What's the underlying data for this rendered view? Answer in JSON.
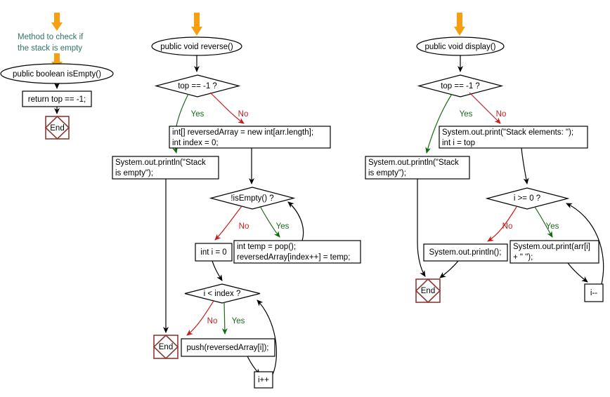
{
  "diagram": {
    "title": "Java Stack methods flowchart",
    "colors": {
      "comment": "#2f7466",
      "yes": "#1a6b1a",
      "no": "#c81c1c",
      "terminator": "#8b3a35",
      "entry_arrow": "#f5a013",
      "edge": "#000000",
      "node_fill": "#ffffff"
    }
  },
  "flows": {
    "is_empty": {
      "comment": {
        "line1": "Method to check if",
        "line2": "the stack is empty"
      },
      "start": "public boolean isEmpty()",
      "statement": "return top == -1;",
      "end": "End"
    },
    "reverse": {
      "start": "public void reverse()",
      "decision_top": "top == -1 ?",
      "label_yes_top": "Yes",
      "label_no_top": "No",
      "empty_print_line1": "System.out.println(\"Stack",
      "empty_print_line2": "is empty\");",
      "alloc_line1": "int[] reversedArray = new int[arr.length];",
      "alloc_line2": "int index = 0;",
      "decision_not_empty": "!isEmpty() ?",
      "label_no_not_empty": "No",
      "label_yes_not_empty": "Yes",
      "pop_line1": "int temp = pop();",
      "pop_line2": "reversedArray[index++] = temp;",
      "init_i": "int i = 0",
      "decision_loop": "i < index ?",
      "label_no_loop": "No",
      "label_yes_loop": "Yes",
      "push": "push(reversedArray[i]);",
      "increment": "i++",
      "end": "End"
    },
    "display": {
      "start": "public void display()",
      "decision_top": "top == -1 ?",
      "label_yes_top": "Yes",
      "label_no_top": "No",
      "empty_print_line1": "System.out.println(\"Stack",
      "empty_print_line2": "is empty\");",
      "header_line1": "System.out.print(\"Stack elements: \");",
      "header_line2": "int i = top",
      "decision_loop": "i >= 0 ?",
      "label_no_loop": "No",
      "label_yes_loop": "Yes",
      "newline": "System.out.println();",
      "print_elem_line1": "System.out.print(arr[i]",
      "print_elem_line2": "+ \" \");",
      "decrement": "i--",
      "end": "End"
    }
  }
}
